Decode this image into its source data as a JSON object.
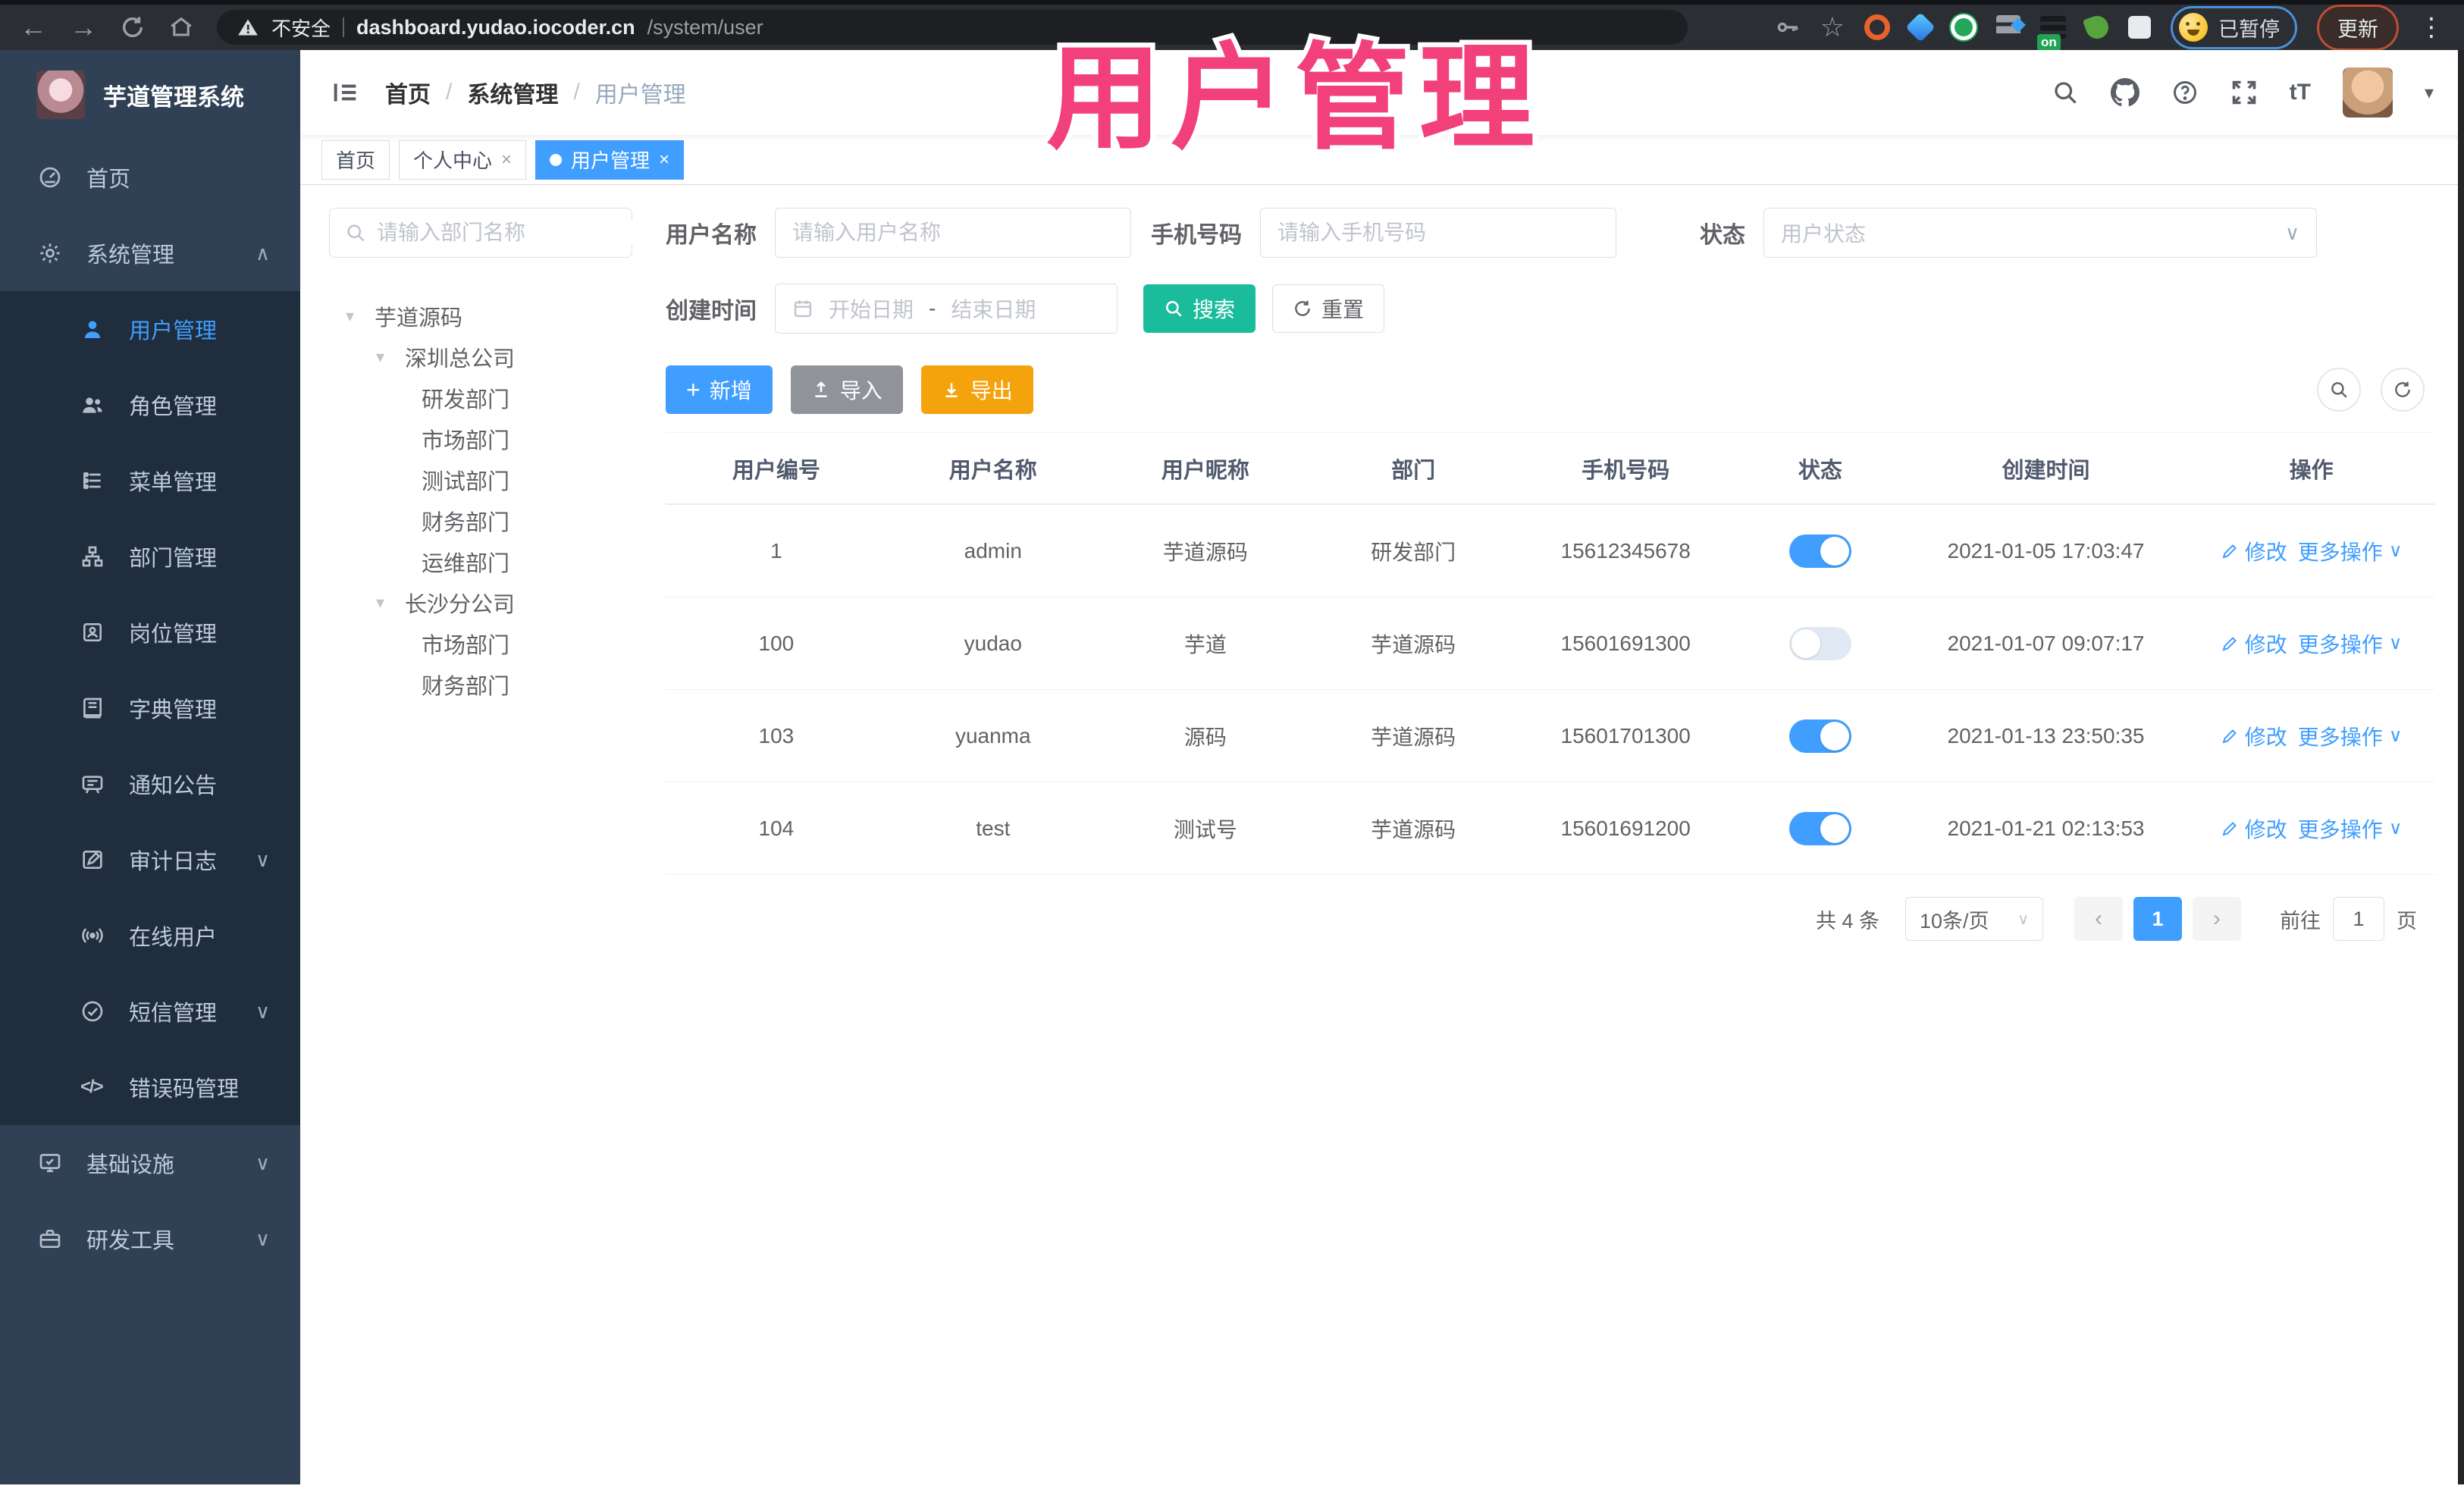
{
  "glyphs": {
    "back": "←",
    "forward": "→",
    "star": "☆",
    "more": "⋮",
    "tsize": "tT",
    "caret_down": "▾",
    "chev_down": "∨",
    "chev_up": "∧",
    "close": "×",
    "plus": "+",
    "qmark": "?",
    "code": "</>",
    "lt": "‹",
    "gt": "›",
    "dash": "-",
    "slash": "/"
  },
  "browser": {
    "security": "不安全",
    "host": "dashboard.yudao.iocoder.cn",
    "path": "/system/user",
    "paused": "已暂停",
    "update": "更新",
    "on_badge": "on"
  },
  "overlay": {
    "title": "用户管理"
  },
  "sidebar": {
    "title": "芋道管理系统",
    "items": [
      {
        "label": "首页"
      },
      {
        "label": "系统管理"
      },
      {
        "label": "用户管理"
      },
      {
        "label": "角色管理"
      },
      {
        "label": "菜单管理"
      },
      {
        "label": "部门管理"
      },
      {
        "label": "岗位管理"
      },
      {
        "label": "字典管理"
      },
      {
        "label": "通知公告"
      },
      {
        "label": "审计日志"
      },
      {
        "label": "在线用户"
      },
      {
        "label": "短信管理"
      },
      {
        "label": "错误码管理"
      },
      {
        "label": "基础设施"
      },
      {
        "label": "研发工具"
      }
    ]
  },
  "breadcrumb": {
    "items": [
      "首页",
      "系统管理",
      "用户管理"
    ]
  },
  "tabs": [
    {
      "label": "首页"
    },
    {
      "label": "个人中心"
    },
    {
      "label": "用户管理"
    }
  ],
  "dept": {
    "placeholder": "请输入部门名称",
    "nodes": [
      {
        "label": "芋道源码"
      },
      {
        "label": "深圳总公司"
      },
      {
        "label": "研发部门"
      },
      {
        "label": "市场部门"
      },
      {
        "label": "测试部门"
      },
      {
        "label": "财务部门"
      },
      {
        "label": "运维部门"
      },
      {
        "label": "长沙分公司"
      },
      {
        "label": "市场部门"
      },
      {
        "label": "财务部门"
      }
    ]
  },
  "filters": {
    "username_label": "用户名称",
    "username_ph": "请输入用户名称",
    "mobile_label": "手机号码",
    "mobile_ph": "请输入手机号码",
    "status_label": "状态",
    "status_ph": "用户状态",
    "date_label": "创建时间",
    "date_start": "开始日期",
    "date_end": "结束日期",
    "search": "搜索",
    "reset": "重置"
  },
  "toolbar": {
    "add": "新增",
    "imp": "导入",
    "exp": "导出"
  },
  "table": {
    "columns": [
      "用户编号",
      "用户名称",
      "用户昵称",
      "部门",
      "手机号码",
      "状态",
      "创建时间",
      "操作"
    ],
    "ops": {
      "modify": "修改",
      "more": "更多操作"
    },
    "rows": [
      {
        "id": "1",
        "username": "admin",
        "nickname": "芋道源码",
        "dept": "研发部门",
        "mobile": "15612345678",
        "status_on": true,
        "created": "2021-01-05 17:03:47"
      },
      {
        "id": "100",
        "username": "yudao",
        "nickname": "芋道",
        "dept": "芋道源码",
        "mobile": "15601691300",
        "status_on": false,
        "created": "2021-01-07 09:07:17"
      },
      {
        "id": "103",
        "username": "yuanma",
        "nickname": "源码",
        "dept": "芋道源码",
        "mobile": "15601701300",
        "status_on": true,
        "created": "2021-01-13 23:50:35"
      },
      {
        "id": "104",
        "username": "test",
        "nickname": "测试号",
        "dept": "芋道源码",
        "mobile": "15601691200",
        "status_on": true,
        "created": "2021-01-21 02:13:53"
      }
    ]
  },
  "pagination": {
    "total": "共 4 条",
    "size": "10条/页",
    "page": "1",
    "goto": "前往",
    "goto_value": "1",
    "suffix": "页"
  }
}
